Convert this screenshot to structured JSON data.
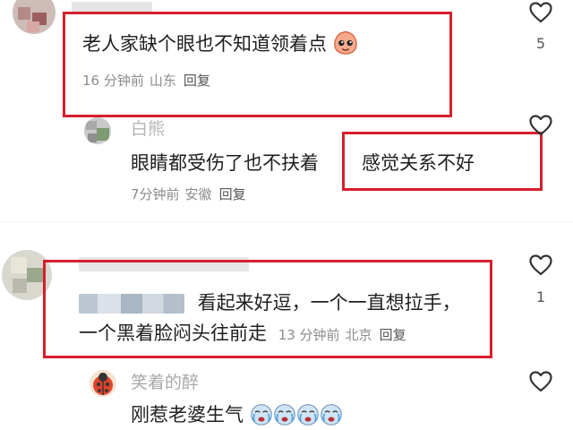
{
  "comments": [
    {
      "text": "老人家缺个眼也不知道领着点",
      "time": "16 分钟前",
      "location": "山东",
      "reply": "回复",
      "like_count": "5"
    },
    {
      "username": "白熊",
      "text_part1": "眼睛都受伤了也不扶着",
      "text_part2": "感觉关系不好",
      "time": "7分钟前",
      "location": "安徽",
      "reply": "回复"
    },
    {
      "text_line1": "看起来好逗，一个一直想拉手，",
      "text_line2": "一个黑着脸闷头往前走",
      "time": "13 分钟前",
      "location": "北京",
      "reply": "回复",
      "like_count": "1"
    },
    {
      "username": "笑着的醉",
      "text": "刚惹老婆生气"
    }
  ],
  "colors": {
    "highlight": "#d61f2c",
    "meta": "#8c8c8c",
    "name": "#9a9a9a"
  },
  "icons": [
    "heart-outline-icon",
    "pleading-face-emoji",
    "crying-face-emoji"
  ]
}
